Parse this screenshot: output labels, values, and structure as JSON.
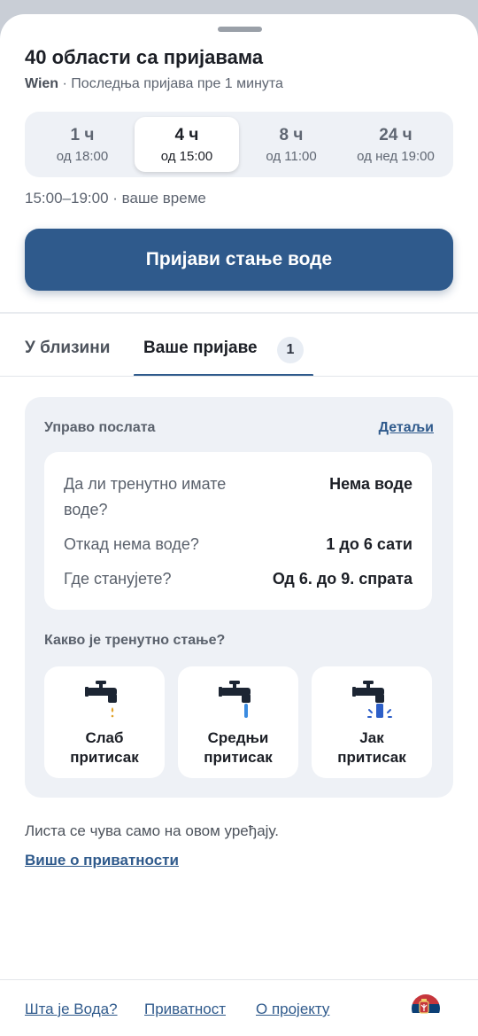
{
  "header": {
    "title": "40 области са пријавама",
    "city": "Wien",
    "last_report": "· Последња пријава пре 1 минута"
  },
  "time_filter": {
    "selected": "4 ч",
    "options": [
      {
        "label": "1 ч",
        "sub": "од 18:00"
      },
      {
        "label": "4 ч",
        "sub": "од 15:00"
      },
      {
        "label": "8 ч",
        "sub": "од 11:00"
      },
      {
        "label": "24 ч",
        "sub": "од нед 19:00"
      }
    ],
    "range_text": "15:00–19:00 · ваше време"
  },
  "cta": {
    "label": "Пријави стање воде"
  },
  "tabs": {
    "nearby": "У близини",
    "reports": "Ваше пријаве",
    "reports_count": "1"
  },
  "report_card": {
    "heading": "Управо послата",
    "details_link": "Детаљи",
    "rows": [
      {
        "question": "Да ли тренутно имате воде?",
        "answer": "Нема воде"
      },
      {
        "question": "Откад нема воде?",
        "answer": "1 до 6 сати"
      },
      {
        "question": "Где станујете?",
        "answer": "Од 6. до 9. спрата"
      }
    ],
    "state_question": "Какво је тренутно стање?",
    "pressure_options": [
      {
        "line1": "Слаб",
        "line2": "притисак",
        "icon": "faucet-drip-icon"
      },
      {
        "line1": "Средњи",
        "line2": "притисак",
        "icon": "faucet-stream-icon"
      },
      {
        "line1": "Јак",
        "line2": "притисак",
        "icon": "faucet-splash-icon"
      }
    ]
  },
  "privacy": {
    "note": "Листа се чува само на овом уређају.",
    "link": "Више о приватности"
  },
  "footer": {
    "links": [
      "Шта је Вода?",
      "Приватност",
      "О пројекту"
    ],
    "language_icon": "serbia-flag-icon"
  },
  "colors": {
    "accent": "#2f5a8c",
    "surface": "#eef1f6",
    "drip": "#e0a22b",
    "stream": "#3a8be0",
    "splash": "#2d5fc8"
  }
}
